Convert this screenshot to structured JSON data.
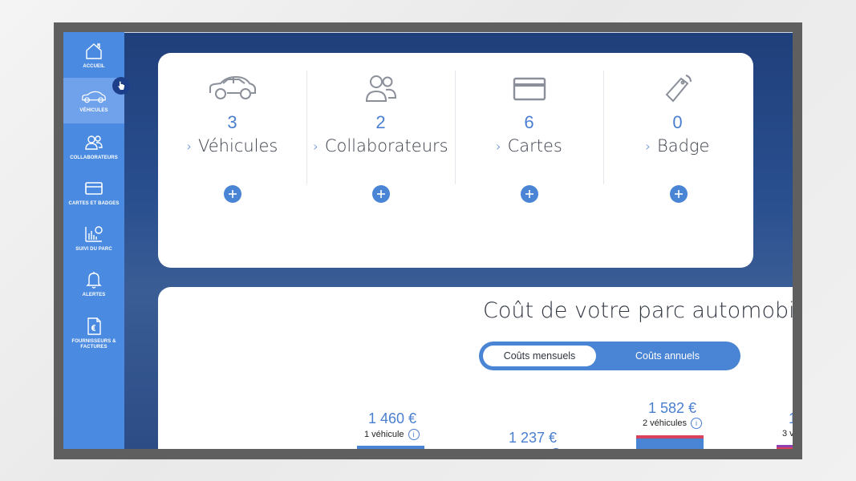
{
  "sidebar": {
    "items": [
      {
        "label": "ACCUEIL",
        "icon": "home-icon"
      },
      {
        "label": "VÉHICULES",
        "icon": "car-icon"
      },
      {
        "label": "COLLABORATEURS",
        "icon": "users-icon"
      },
      {
        "label": "CARTES ET BADGES",
        "icon": "card-icon"
      },
      {
        "label": "SUIVI DU PARC",
        "icon": "chart-icon"
      },
      {
        "label": "ALERTES",
        "icon": "bell-icon"
      },
      {
        "label": "FOURNISSEURS & FACTURES",
        "icon": "invoice-icon"
      }
    ],
    "active_index": 1
  },
  "stats": [
    {
      "count": "3",
      "label": "Véhicules",
      "icon": "car-icon"
    },
    {
      "count": "2",
      "label": "Collaborateurs",
      "icon": "users-icon"
    },
    {
      "count": "6",
      "label": "Cartes",
      "icon": "card-icon"
    },
    {
      "count": "0",
      "label": "Badge",
      "icon": "badge-icon"
    }
  ],
  "cost": {
    "title": "Coût de votre parc automobile",
    "toggle": {
      "monthly": "Coûts mensuels",
      "annual": "Coûts annuels",
      "selected": "monthly"
    },
    "bars": [
      {
        "value": "1 460 €",
        "sub": "1 véhicule"
      },
      {
        "value": "1 237 €",
        "sub": ""
      },
      {
        "value": "1 582 €",
        "sub": "2 véhicules"
      },
      {
        "value": "1",
        "sub": "3 v"
      }
    ]
  },
  "colors": {
    "accent": "#4a84d4",
    "sidebar": "#4a8ae0",
    "bar_blue": "#4a84d4",
    "bar_red": "#d9425a",
    "bar_purple": "#8e3fb0"
  }
}
